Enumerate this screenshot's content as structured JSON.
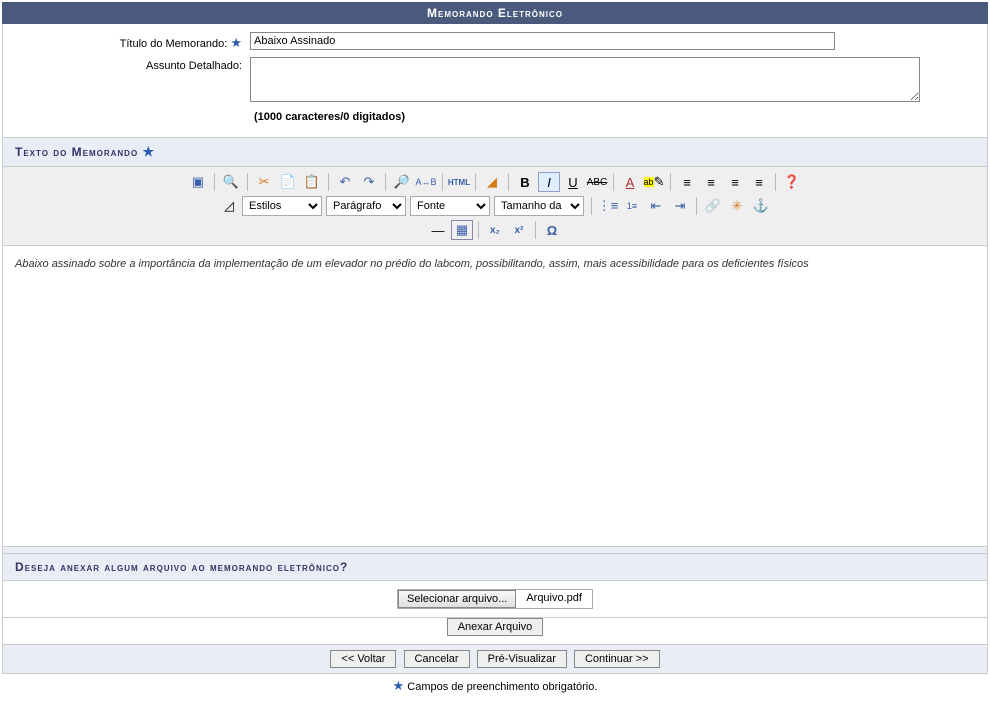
{
  "header": {
    "title": "Memorando Eletrônico"
  },
  "form": {
    "titulo_label": "Título do Memorando:",
    "titulo_value": "Abaixo Assinado",
    "assunto_label": "Assunto Detalhado:",
    "assunto_value": "",
    "char_counter": "(1000 caracteres/0 digitados)"
  },
  "section": {
    "texto_header": "Texto do Memorando",
    "anexo_header": "Deseja anexar algum arquivo ao memorando eletrônico?"
  },
  "editor": {
    "styles_select": "Estilos",
    "paragraph_select": "Parágrafo",
    "font_select": "Fonte",
    "size_select": "Tamanho da Fo",
    "html_label": "HTML",
    "content": "Abaixo assinado sobre a importância da implementação de um elevador no prédio do labcom, possibilitando, assim, mais acessibilidade para os deficientes físicos"
  },
  "file": {
    "select_label": "Selecionar arquivo...",
    "filename": "Arquivo.pdf",
    "attach_button": "Anexar Arquivo"
  },
  "buttons": {
    "back": "<< Voltar",
    "cancel": "Cancelar",
    "preview": "Pré-Visualizar",
    "continue": "Continuar >>"
  },
  "footnote": "Campos de preenchimento obrigatório."
}
